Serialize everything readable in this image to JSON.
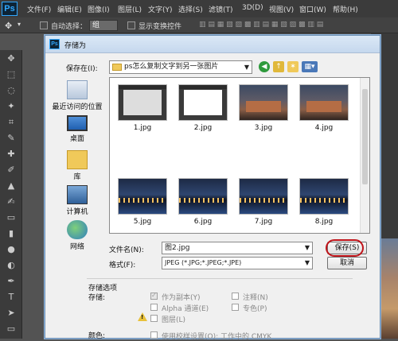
{
  "app": {
    "logo": "Ps"
  },
  "menu": [
    "文件(F)",
    "编辑(E)",
    "图像(I)",
    "图层(L)",
    "文字(Y)",
    "选择(S)",
    "滤镜(T)",
    "3D(D)",
    "视图(V)",
    "窗口(W)",
    "帮助(H)"
  ],
  "options_bar": {
    "auto_select_label": "自动选择：",
    "auto_select_value": "组",
    "show_transform_label": "显示变换控件"
  },
  "dialog": {
    "title": "存储为",
    "save_in_label": "保存在(I):",
    "save_in_value": "ps怎么复制文字到另一张图片",
    "places": [
      "最近访问的位置",
      "桌面",
      "库",
      "计算机",
      "网络"
    ],
    "files": [
      {
        "name": "1.jpg",
        "kind": "screenshot"
      },
      {
        "name": "2.jpg",
        "kind": "screenshot"
      },
      {
        "name": "3.jpg",
        "kind": "photo"
      },
      {
        "name": "4.jpg",
        "kind": "photo"
      },
      {
        "name": "5.jpg",
        "kind": "night"
      },
      {
        "name": "6.jpg",
        "kind": "night"
      },
      {
        "name": "7.jpg",
        "kind": "night"
      },
      {
        "name": "8.jpg",
        "kind": "night"
      }
    ],
    "filename_label": "文件名(N):",
    "filename_value": "图2.jpg",
    "format_label": "格式(F):",
    "format_value": "JPEG (*.JPG;*.JPEG;*.JPE)",
    "save_button": "保存(S)",
    "cancel_button": "取消",
    "options": {
      "section_label": "存储选项",
      "save_label": "存储:",
      "as_copy": "作为副本(Y)",
      "alpha": "Alpha 通道(E)",
      "layers": "图层(L)",
      "notes": "注释(N)",
      "spot": "专色(P)",
      "color_label": "颜色:",
      "use_proof": "使用校样设置(O): 工作中的 CMYK"
    }
  },
  "colors": {
    "accent_ps": "#31a8ff",
    "highlight_ring": "#c0141a"
  }
}
